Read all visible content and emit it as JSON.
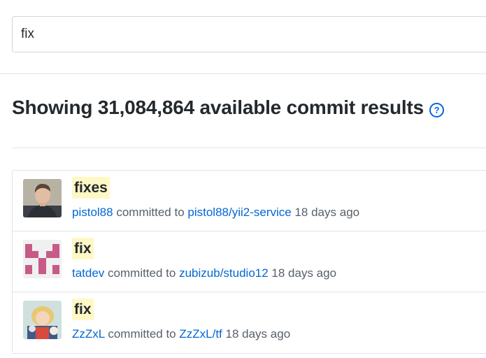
{
  "search": {
    "value": "fix"
  },
  "results": {
    "heading": "Showing 31,084,864 available commit results",
    "help_icon_glyph": "?"
  },
  "commits": [
    {
      "title": "fixes",
      "author": "pistol88",
      "verb": "committed to",
      "repo": "pistol88/yii2-service",
      "time": "18 days ago"
    },
    {
      "title": "fix",
      "author": "tatdev",
      "verb": "committed to",
      "repo": "zubizub/studio12",
      "time": "18 days ago"
    },
    {
      "title": "fix",
      "author": "ZzZxL",
      "verb": "committed to",
      "repo": "ZzZxL/tf",
      "time": "18 days ago"
    }
  ],
  "colors": {
    "link": "#0366d6",
    "highlight": "#fff8c5",
    "text": "#24292e",
    "muted": "#586069"
  },
  "icons": [
    "help-circle-icon"
  ]
}
